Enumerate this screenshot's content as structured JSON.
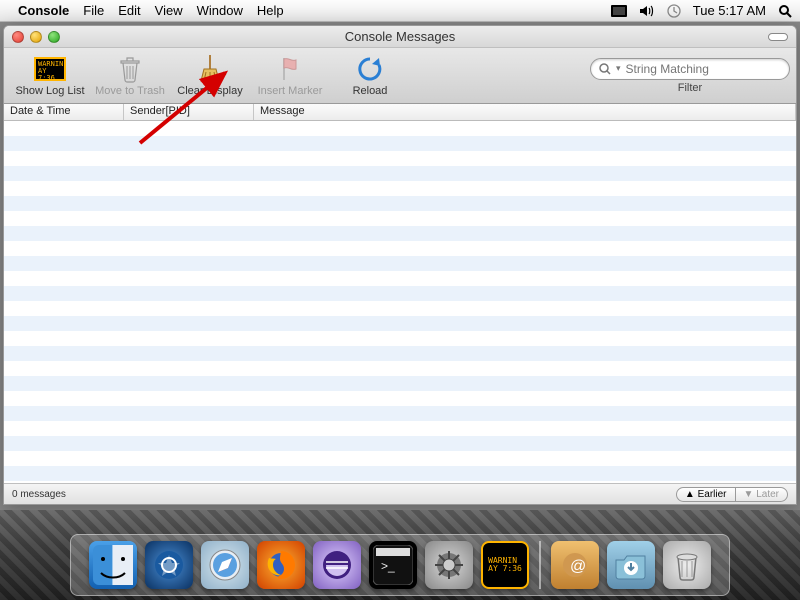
{
  "menubar": {
    "app": "Console",
    "items": [
      "File",
      "Edit",
      "View",
      "Window",
      "Help"
    ],
    "clock": "Tue 5:17 AM"
  },
  "window": {
    "title": "Console Messages",
    "toolbar": {
      "show_log_list": "Show Log List",
      "move_to_trash": "Move to Trash",
      "clear_display": "Clear Display",
      "insert_marker": "Insert Marker",
      "reload": "Reload",
      "search_placeholder": "String Matching",
      "filter_label": "Filter"
    },
    "columns": {
      "date_time": "Date & Time",
      "sender_pid": "Sender[PID]",
      "message": "Message"
    },
    "status": {
      "count": "0 messages",
      "earlier": "Earlier",
      "later": "Later"
    }
  },
  "dock": {
    "items": [
      {
        "name": "finder"
      },
      {
        "name": "app-store"
      },
      {
        "name": "safari"
      },
      {
        "name": "firefox"
      },
      {
        "name": "eclipse"
      },
      {
        "name": "terminal"
      },
      {
        "name": "system-preferences"
      },
      {
        "name": "console"
      },
      {
        "name": "mail"
      },
      {
        "name": "downloads"
      },
      {
        "name": "trash"
      }
    ]
  }
}
